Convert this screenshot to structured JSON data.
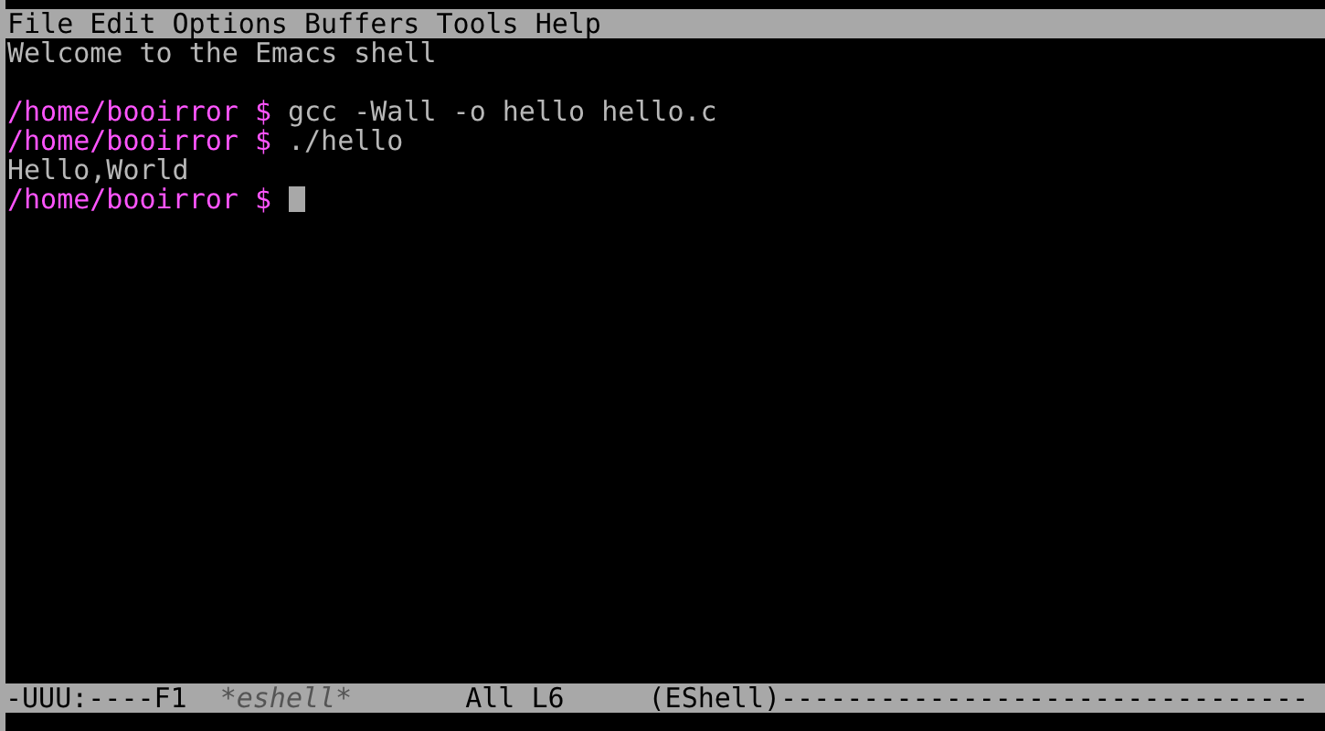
{
  "menu_bar": [
    "File",
    "Edit",
    "Options",
    "Buffers",
    "Tools",
    "Help"
  ],
  "lines": [
    {
      "kind": "output",
      "text": "Welcome to the Emacs shell"
    },
    {
      "kind": "blank"
    },
    {
      "kind": "prompt",
      "prompt": "/home/booirror $",
      "command": "gcc -Wall -o hello hello.c"
    },
    {
      "kind": "prompt",
      "prompt": "/home/booirror $",
      "command": "./hello"
    },
    {
      "kind": "output",
      "text": "Hello,World"
    },
    {
      "kind": "prompt",
      "prompt": "/home/booirror $",
      "cursor": true
    }
  ],
  "mode_line": {
    "status": "-UUU:----F1",
    "buffer": "*eshell*",
    "position": "All L6",
    "mode": "(EShell)--------------------------------"
  }
}
